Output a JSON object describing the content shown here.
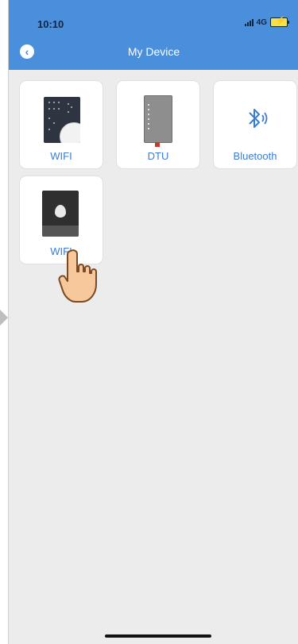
{
  "status_bar": {
    "time": "10:10",
    "network": "4G"
  },
  "header": {
    "title": "My Device"
  },
  "devices": [
    {
      "label": "WIFI",
      "icon": "wifi-device-panel-icon"
    },
    {
      "label": "DTU",
      "icon": "dtu-module-icon"
    },
    {
      "label": "Bluetooth",
      "icon": "bluetooth-icon"
    },
    {
      "label": "WIFI",
      "icon": "wifi-device-dark-icon"
    }
  ],
  "colors": {
    "header": "#4a8fdb",
    "label": "#3b7cd2",
    "background": "#ececec"
  }
}
